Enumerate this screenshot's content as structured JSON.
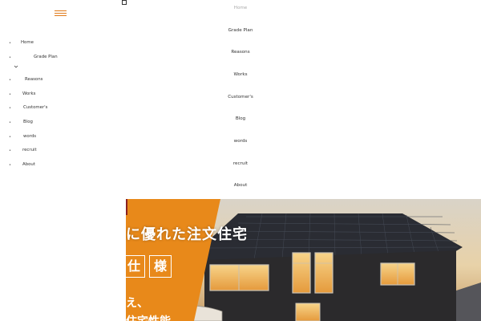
{
  "sidebar": {
    "items": [
      {
        "label": "Home"
      },
      {
        "label": "Grade Plan"
      },
      {
        "label": "Reasons"
      },
      {
        "label": "Works"
      },
      {
        "label": "Customer's"
      },
      {
        "label": "Blog"
      },
      {
        "label": "words"
      },
      {
        "label": "recruit"
      },
      {
        "label": "About"
      }
    ],
    "bullet": "•"
  },
  "topnav": {
    "items": [
      {
        "label": "Home"
      },
      {
        "label": "Grade Plan"
      },
      {
        "label": "Reasons"
      },
      {
        "label": "Works"
      },
      {
        "label": "Customer's"
      },
      {
        "label": "Blog"
      },
      {
        "label": "words"
      },
      {
        "label": "recruit"
      },
      {
        "label": "About"
      }
    ]
  },
  "hero": {
    "headline": "に優れた注文住宅",
    "badge_1": "仕",
    "badge_2": "様",
    "line_3": "え、",
    "line_4": "住宅性能"
  },
  "colors": {
    "accent": "#e8891a",
    "dark_wall": "#2b2a2c"
  }
}
